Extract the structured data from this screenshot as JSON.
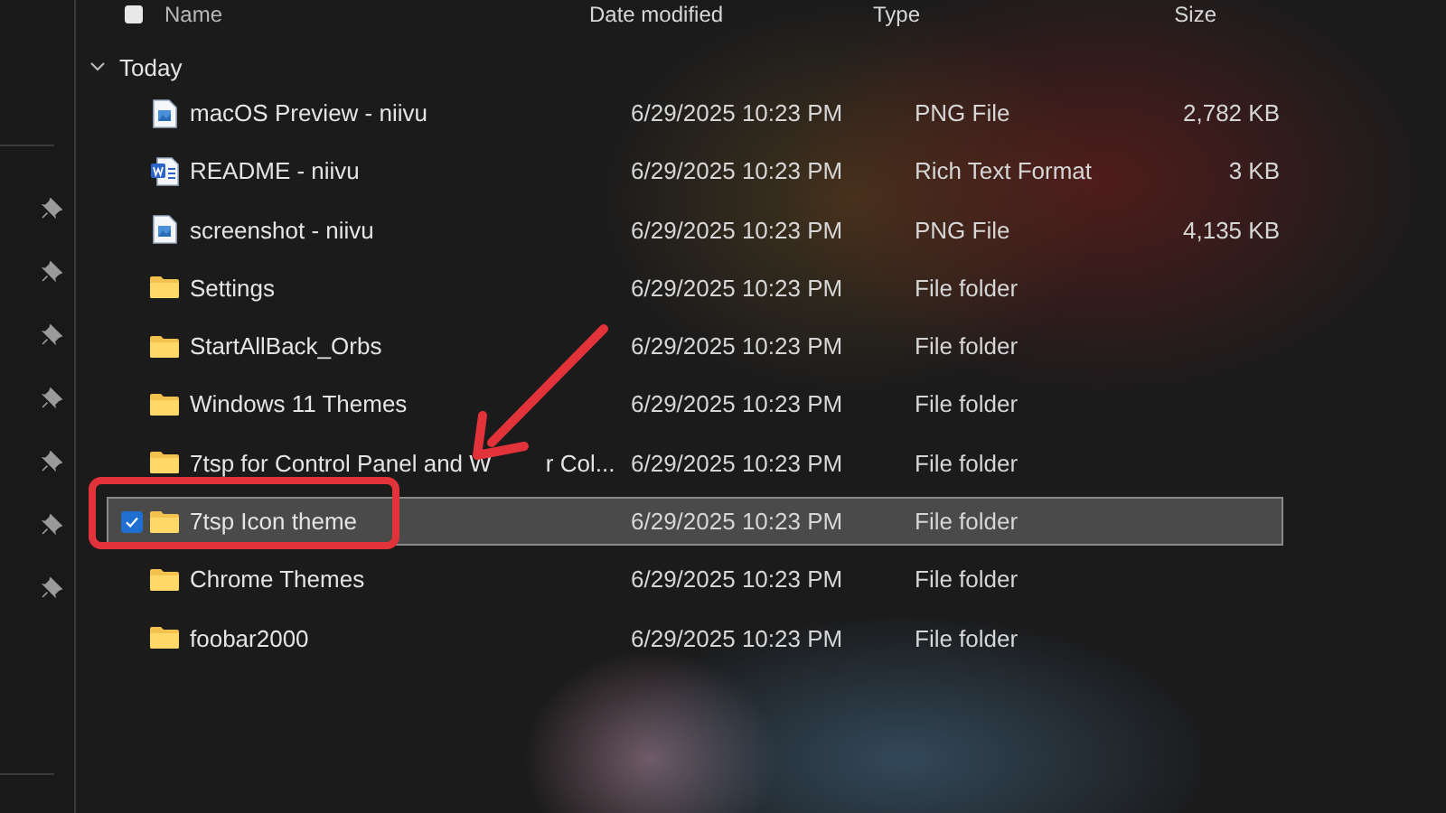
{
  "select_all": {
    "checked": false
  },
  "columns": [
    {
      "label": "Name"
    },
    {
      "label": "Date modified"
    },
    {
      "label": "Type"
    },
    {
      "label": "Size"
    }
  ],
  "group": {
    "label": "Today",
    "expanded": true
  },
  "rows": [
    {
      "kind": "image",
      "name": "macOS Preview - niivu",
      "date": "6/29/2025 10:23 PM",
      "type": "PNG File",
      "size": "2,782 KB",
      "selected": false
    },
    {
      "kind": "document",
      "name": "README - niivu",
      "date": "6/29/2025 10:23 PM",
      "type": "Rich Text Format",
      "size": "3 KB",
      "selected": false
    },
    {
      "kind": "image",
      "name": "screenshot - niivu",
      "date": "6/29/2025 10:23 PM",
      "type": "PNG File",
      "size": "4,135 KB",
      "selected": false
    },
    {
      "kind": "folder",
      "name": "Settings",
      "date": "6/29/2025 10:23 PM",
      "type": "File folder",
      "selected": false
    },
    {
      "kind": "folder",
      "name": "StartAllBack_Orbs",
      "date": "6/29/2025 10:23 PM",
      "type": "File folder",
      "selected": false
    },
    {
      "kind": "folder",
      "name": "Windows 11 Themes",
      "date": "6/29/2025 10:23 PM",
      "type": "File folder",
      "selected": false
    },
    {
      "kind": "folder",
      "name": "7tsp for Control Panel and W",
      "name_tail": "r Col...",
      "date": "6/29/2025 10:23 PM",
      "type": "File folder",
      "selected": false
    },
    {
      "kind": "folder",
      "name": "7tsp Icon theme",
      "date": "6/29/2025 10:23 PM",
      "type": "File folder",
      "selected": true
    },
    {
      "kind": "folder",
      "name": "Chrome Themes",
      "date": "6/29/2025 10:23 PM",
      "type": "File folder",
      "selected": false
    },
    {
      "kind": "folder",
      "name": "foobar2000",
      "date": "6/29/2025 10:23 PM",
      "type": "File folder",
      "selected": false
    }
  ],
  "sidebar": {
    "pins": [
      {
        "pinned": true
      },
      {
        "pinned": true
      },
      {
        "pinned": true
      },
      {
        "pinned": true
      },
      {
        "pinned": true
      },
      {
        "pinned": true
      },
      {
        "pinned": true
      }
    ]
  }
}
